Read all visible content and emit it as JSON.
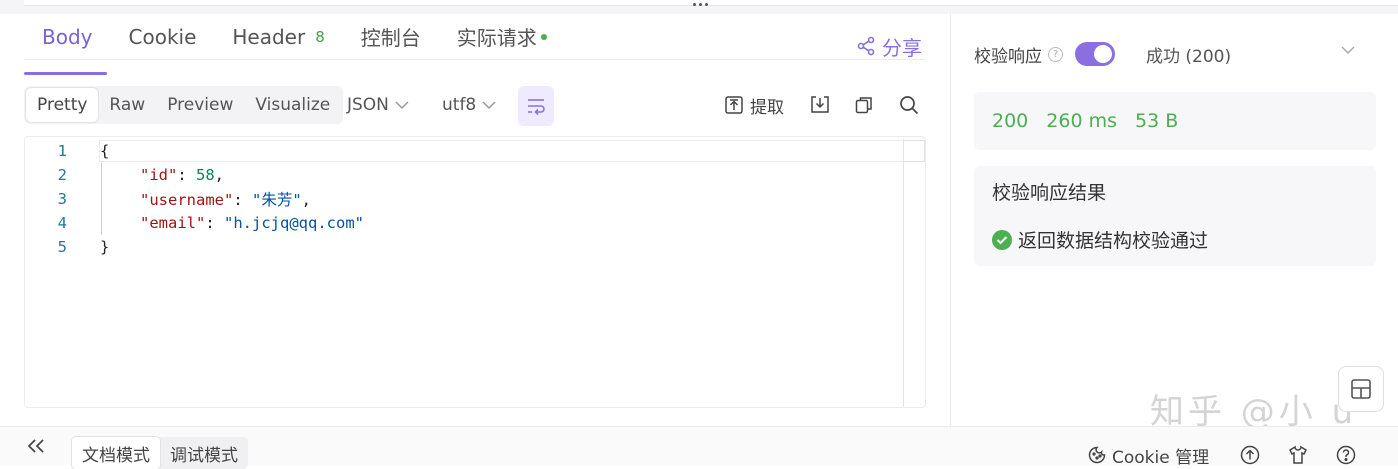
{
  "tabs": [
    {
      "label": "Body",
      "active": true
    },
    {
      "label": "Cookie"
    },
    {
      "label": "Header",
      "badge": "8"
    },
    {
      "label": "控制台"
    },
    {
      "label": "实际请求",
      "has_dot": true
    }
  ],
  "share_label": "分享",
  "view_modes": [
    "Pretty",
    "Raw",
    "Preview",
    "Visualize"
  ],
  "selected_view": "Pretty",
  "format_select": "JSON",
  "encoding_select": "utf8",
  "extract_label": "提取",
  "editor": {
    "line_numbers": [
      "1",
      "2",
      "3",
      "4",
      "5"
    ],
    "open_brace": "{",
    "close_brace": "}",
    "fields": [
      {
        "key": "\"id\"",
        "value": "58",
        "type": "number",
        "comma": ","
      },
      {
        "key": "\"username\"",
        "value": "\"朱芳\"",
        "type": "string",
        "comma": ","
      },
      {
        "key": "\"email\"",
        "value": "\"h.jcjq@qq.com\"",
        "type": "string",
        "comma": ""
      }
    ]
  },
  "validate": {
    "label": "校验响应",
    "help": "?",
    "enabled": true,
    "status_select": "成功 (200)"
  },
  "stats": {
    "status": "200",
    "time": "260 ms",
    "size": "53 B"
  },
  "result": {
    "title": "校验响应结果",
    "message": "返回数据结构校验通过"
  },
  "watermark": "知乎 @小 u",
  "bottom": {
    "modes": [
      "文档模式",
      "调试模式"
    ],
    "selected_mode": "文档模式",
    "cookie_manage": "Cookie 管理"
  },
  "colors": {
    "accent": "#8b6fe0",
    "success": "#4caf50"
  }
}
